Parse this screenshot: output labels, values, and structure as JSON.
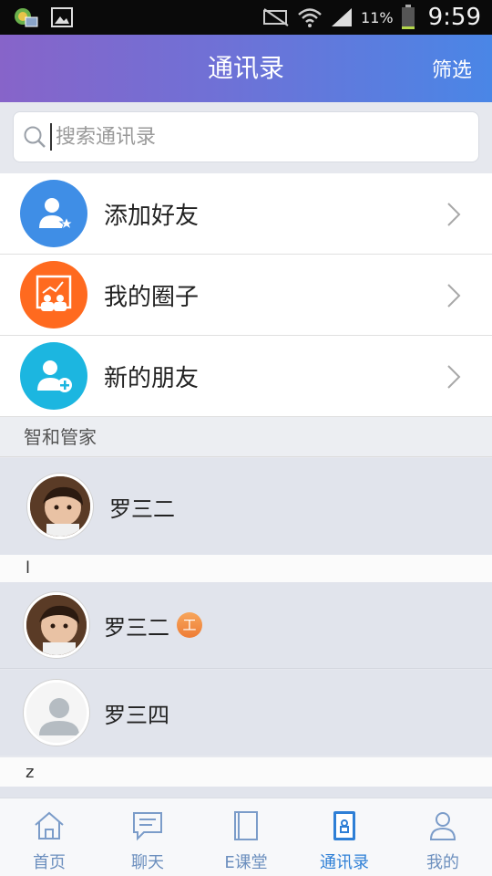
{
  "status_bar": {
    "battery_percent": "11%",
    "time": "9:59"
  },
  "header": {
    "title": "通讯录",
    "filter_label": "筛选"
  },
  "search": {
    "placeholder": "搜索通讯录"
  },
  "menu": {
    "items": [
      {
        "label": "添加好友",
        "icon": "user-star-icon",
        "color": "#3f8ee6"
      },
      {
        "label": "我的圈子",
        "icon": "group-board-icon",
        "color": "#ff6a1f"
      },
      {
        "label": "新的朋友",
        "icon": "user-plus-icon",
        "color": "#1cb6e0"
      }
    ]
  },
  "sections": {
    "zhihe_label": "智和管家",
    "zhihe_contact": "罗三二",
    "letter_l": "l",
    "l_contacts": [
      {
        "name": "罗三二",
        "badge": "工"
      },
      {
        "name": "罗三四"
      }
    ],
    "letter_z": "z"
  },
  "bottom_nav": {
    "items": [
      {
        "label": "首页",
        "icon": "home-icon"
      },
      {
        "label": "聊天",
        "icon": "chat-icon"
      },
      {
        "label": "E课堂",
        "icon": "book-icon"
      },
      {
        "label": "通讯录",
        "icon": "contacts-icon",
        "active": true
      },
      {
        "label": "我的",
        "icon": "profile-icon"
      }
    ]
  }
}
